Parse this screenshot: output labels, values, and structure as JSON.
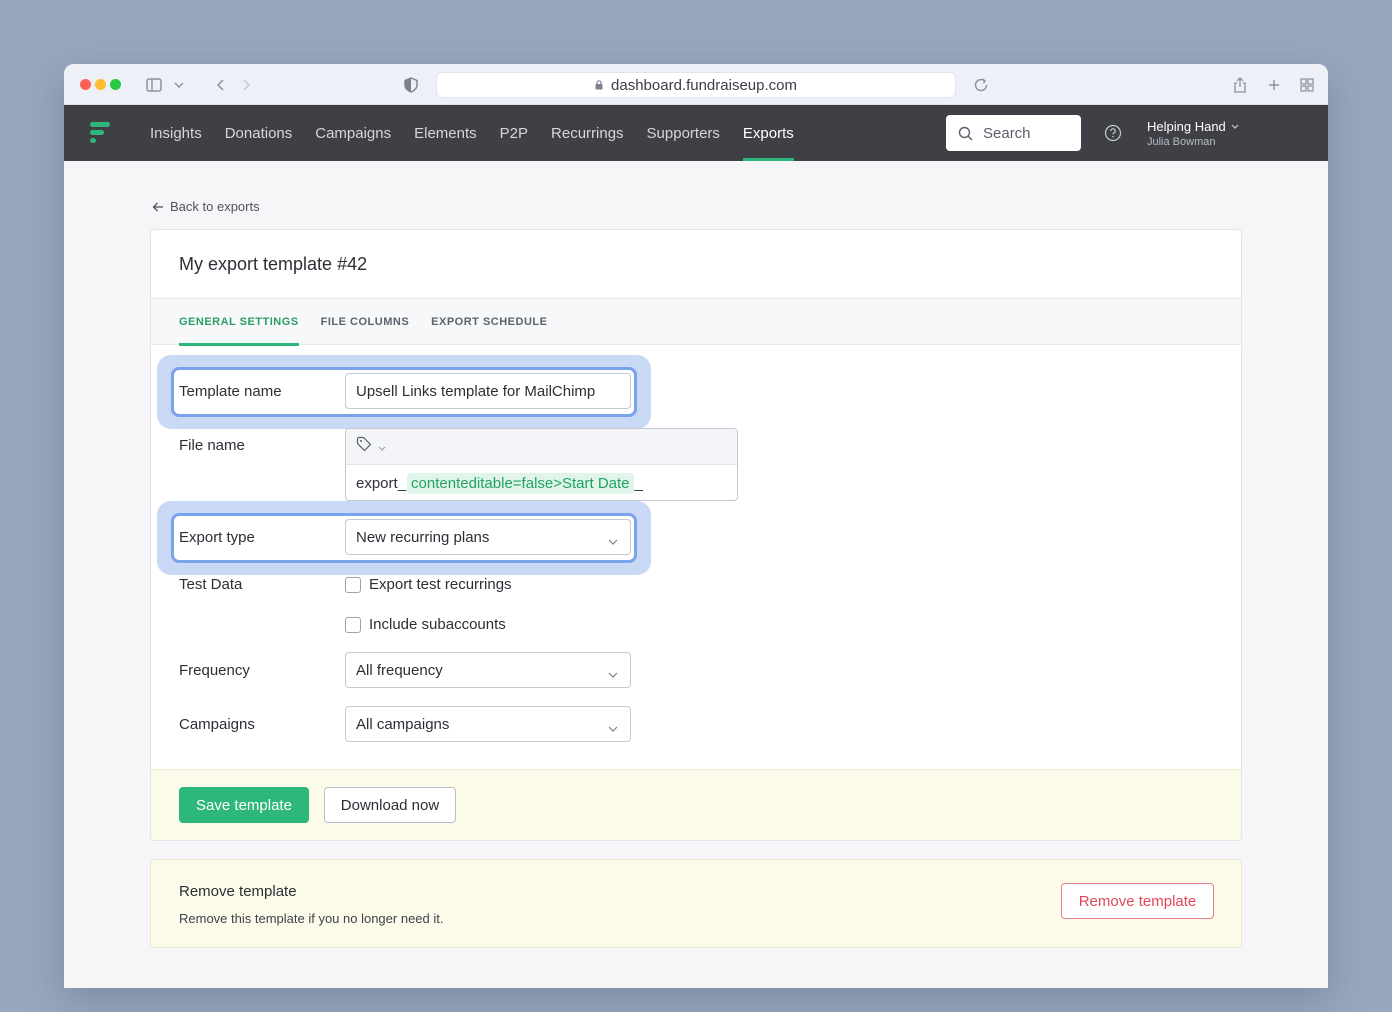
{
  "browser": {
    "url": "dashboard.fundraiseup.com"
  },
  "nav": {
    "items": [
      {
        "label": "Insights"
      },
      {
        "label": "Donations"
      },
      {
        "label": "Campaigns"
      },
      {
        "label": "Elements"
      },
      {
        "label": "P2P"
      },
      {
        "label": "Recurrings"
      },
      {
        "label": "Supporters"
      },
      {
        "label": "Exports",
        "active": true
      }
    ],
    "search_label": "Search",
    "account_org": "Helping Hand",
    "account_user": "Julia Bowman"
  },
  "page": {
    "back_link": "Back to exports",
    "title": "My export template #42",
    "tabs": [
      {
        "label": "GENERAL SETTINGS",
        "active": true
      },
      {
        "label": "FILE COLUMNS"
      },
      {
        "label": "EXPORT SCHEDULE"
      }
    ]
  },
  "form": {
    "template_name_label": "Template name",
    "template_name_value": "Upsell Links template for MailChimp",
    "file_name_label": "File name",
    "file_name_prefix": "export_",
    "file_name_token": "contenteditable=false>Start Date",
    "file_name_suffix": "_",
    "export_type_label": "Export type",
    "export_type_value": "New recurring plans",
    "test_data_label": "Test Data",
    "export_test_label": "Export test recurrings",
    "include_sub_label": "Include subaccounts",
    "frequency_label": "Frequency",
    "frequency_value": "All frequency",
    "campaigns_label": "Campaigns",
    "campaigns_value": "All campaigns"
  },
  "footer": {
    "save_label": "Save template",
    "download_label": "Download now"
  },
  "remove": {
    "title": "Remove template",
    "description": "Remove this template if you no longer need it.",
    "button_label": "Remove template"
  },
  "colors": {
    "accent": "#2db77a",
    "nav_bg": "#3e4046",
    "danger": "#e0475c",
    "highlight": "#7aa3ea"
  }
}
